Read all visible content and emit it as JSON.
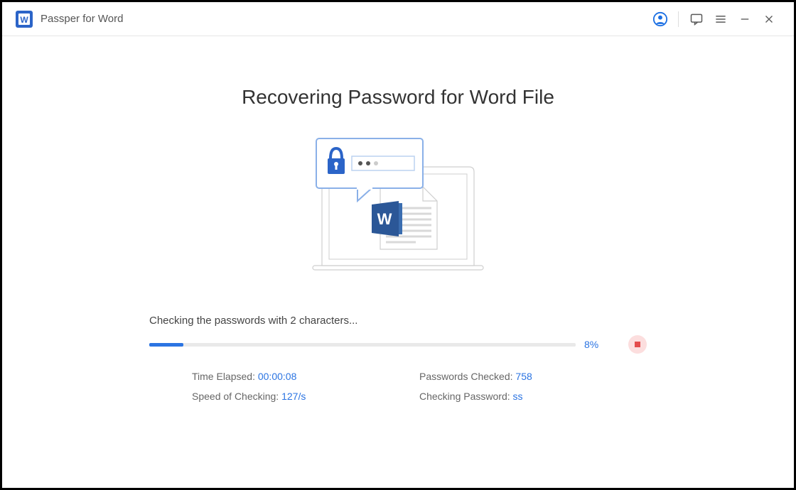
{
  "app": {
    "title": "Passper for Word"
  },
  "main": {
    "heading": "Recovering Password for Word File",
    "status": "Checking the passwords with 2 characters...",
    "progress_percent": "8%",
    "progress_width": "8%"
  },
  "stats": {
    "time_elapsed_label": "Time Elapsed: ",
    "time_elapsed": "00:00:08",
    "speed_label": "Speed of Checking: ",
    "speed": "127/s",
    "checked_label": "Passwords Checked: ",
    "checked": "758",
    "current_label": "Checking Password: ",
    "current": "ss"
  }
}
